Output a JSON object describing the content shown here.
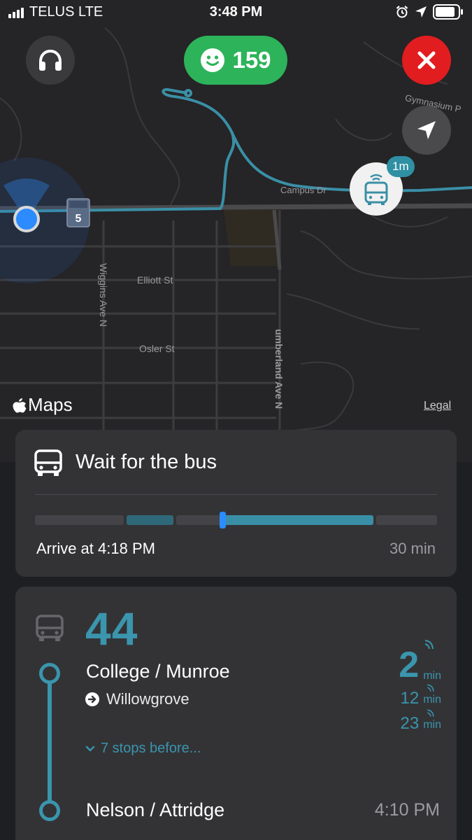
{
  "status_bar": {
    "carrier": "TELUS LTE",
    "time": "3:48 PM"
  },
  "map": {
    "score": "159",
    "streets": {
      "campus": "Campus Dr",
      "gymnasium": "Gymnasium P",
      "elliott": "Elliott St",
      "osler": "Osler St",
      "wiggins": "Wiggins Ave N",
      "cumberland": "umberland Ave N"
    },
    "route_shield": "5",
    "bus_eta_badge": "1m",
    "maps_logo": "Maps",
    "legal": "Legal",
    "colors": {
      "route": "#3a8fa6",
      "score": "#2db35a",
      "close": "#e21d1f",
      "user": "#2b8bff"
    }
  },
  "wait_card": {
    "title": "Wait for the bus",
    "arrive": "Arrive at 4:18 PM",
    "duration": "30 min"
  },
  "route_card": {
    "route_number": "44",
    "stop_a": "College / Munroe",
    "destination": "Willowgrove",
    "more_stops": "7 stops before...",
    "stop_b": "Nelson / Attridge",
    "stop_b_time": "4:10 PM",
    "departures": [
      {
        "value": "2",
        "unit": "min"
      },
      {
        "value": "12",
        "unit": "min"
      },
      {
        "value": "23",
        "unit": "min"
      }
    ]
  }
}
